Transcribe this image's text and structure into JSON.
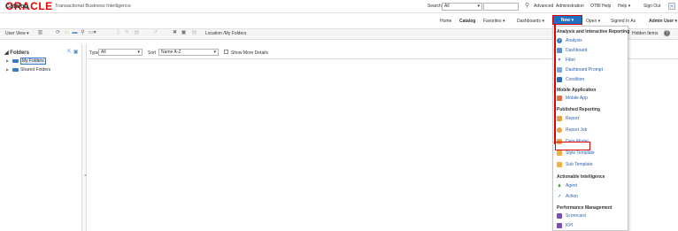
{
  "topbar": {
    "logo": "ORACLE",
    "product": "Transactional Business Intelligence",
    "search_label": "Search",
    "search_scope": "All",
    "links": [
      "Advanced",
      "Administration",
      "OTBI Help",
      "Help",
      "Sign Out"
    ]
  },
  "header": {
    "title": "Catalog",
    "nav": [
      "Home",
      "Catalog",
      "Favorites",
      "Dashboards"
    ],
    "new_label": "New",
    "open_label": "Open",
    "signed_in_label": "Signed In As",
    "user": "Admin User"
  },
  "toolbar": {
    "user_view": "User View",
    "location": "Location /My Folders",
    "hidden_items": "Hidden Items"
  },
  "folders": {
    "title": "Folders",
    "items": [
      {
        "label": "My Folders",
        "selected": true
      },
      {
        "label": "Shared Folders",
        "selected": false
      }
    ]
  },
  "filters": {
    "type_label": "Type",
    "type_value": "All",
    "sort_label": "Sort",
    "sort_value": "Name A-Z",
    "more_details": "Show More Details"
  },
  "new_menu": {
    "sections": [
      {
        "title": "Analysis and Interactive Reporting",
        "items": [
          "Analysis",
          "Dashboard",
          "Filter",
          "Dashboard Prompt",
          "Condition"
        ]
      },
      {
        "title": "Mobile Application",
        "items": [
          "Mobile App"
        ]
      },
      {
        "title": "Published Reporting",
        "items": [
          "Report",
          "Report Job",
          "Data Model",
          "Style Template",
          "Sub Template"
        ]
      },
      {
        "title": "Actionable Intelligence",
        "items": [
          "Agent",
          "Action"
        ]
      },
      {
        "title": "Performance Management",
        "items": [
          "Scorecard",
          "KPI"
        ]
      }
    ],
    "highlighted": "Data Model"
  },
  "colors": {
    "brand_red": "#e00000",
    "accent_blue": "#1f6fc2",
    "highlight_red": "#dd0000"
  }
}
